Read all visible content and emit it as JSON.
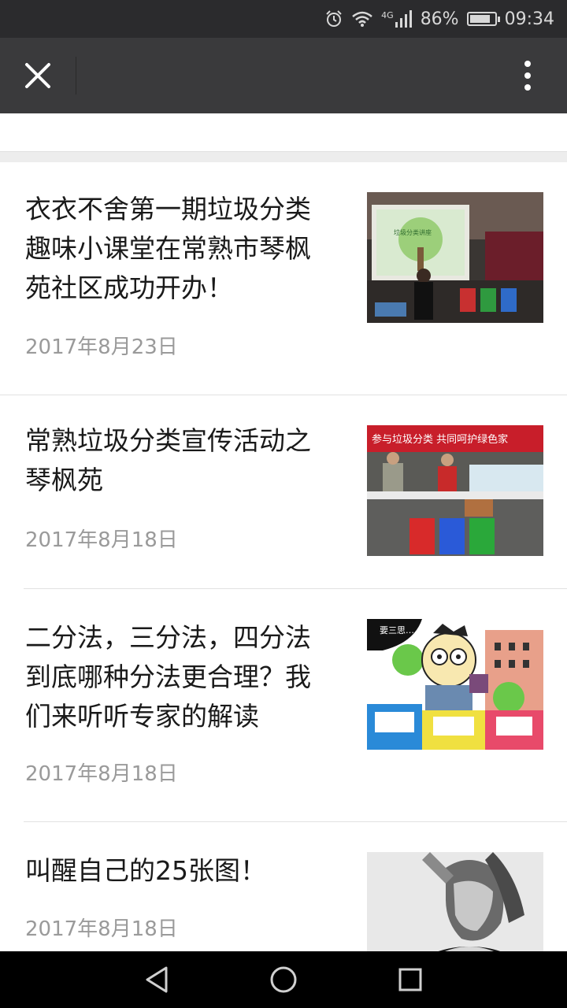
{
  "status_bar": {
    "network": "4G",
    "battery_percent": "86%",
    "battery_level": 0.86,
    "time": "09:34",
    "icons": [
      "alarm-icon",
      "wifi-icon",
      "signal-icon",
      "battery-icon"
    ]
  },
  "title_bar": {
    "icons": [
      "close-icon",
      "more-icon"
    ]
  },
  "articles": [
    {
      "title_lines": [
        "衣衣不舍第一期垃圾分类",
        "趣味小课堂在常熟市琴枫",
        "苑社区成功开办！"
      ],
      "date": "2017年8月23日",
      "thumb_text": "垃圾分类讲座"
    },
    {
      "title_lines": [
        "常熟垃圾分类宣传活动之",
        "琴枫苑"
      ],
      "date": "2017年8月18日",
      "thumb_text": "参与垃圾分类 共同呵护绿色家"
    },
    {
      "title_lines": [
        "二分法，三分法，四分法",
        "到底哪种分法更合理？我",
        "们来听听专家的解读"
      ],
      "date": "2017年8月18日",
      "thumb_text": "要三思……"
    },
    {
      "title_lines": [
        "叫醒自己的25张图！"
      ],
      "date": "2017年8月18日"
    }
  ],
  "nav_bar": {
    "icons": [
      "back-icon",
      "home-icon",
      "recents-icon"
    ]
  },
  "colors": {
    "status_bar_bg": "#2b2b2d",
    "title_bar_bg": "#3a3a3c",
    "title_text": "#1a1a1a",
    "date_text": "#9a9a9a",
    "nav_bar_bg": "#000000"
  }
}
